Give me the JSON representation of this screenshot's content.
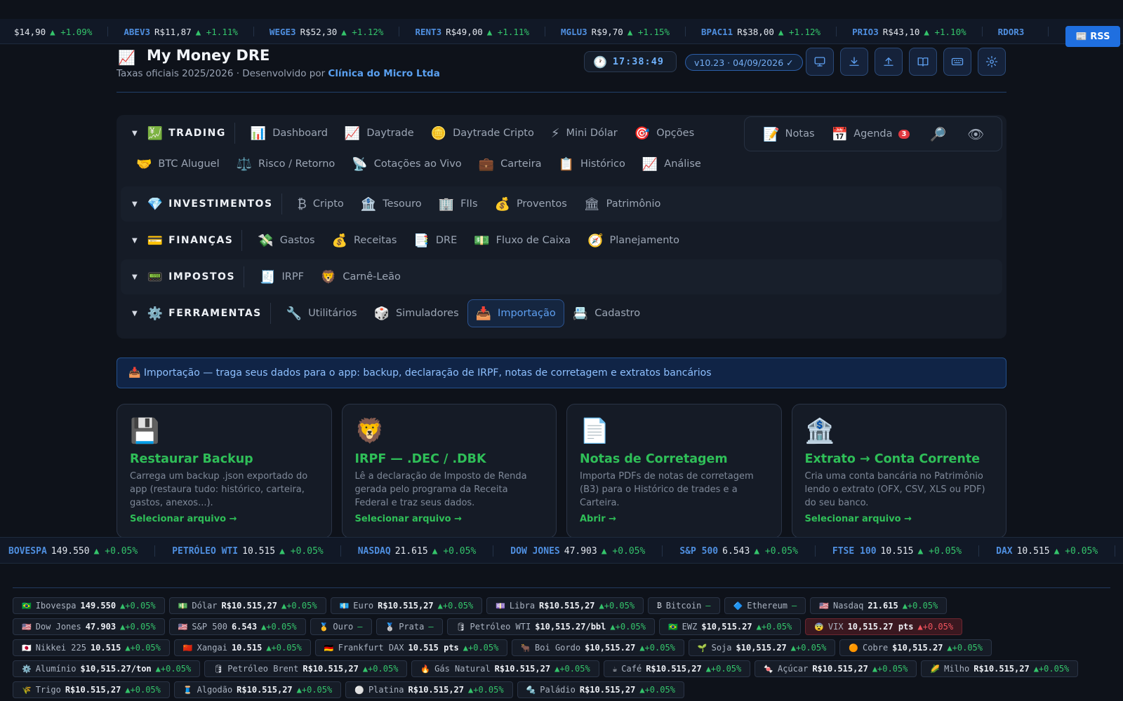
{
  "ticker_top": [
    {
      "symbol": "",
      "price": "$14,90",
      "change": "▲ +1.09%"
    },
    {
      "symbol": "ABEV3",
      "price": "R$11,87",
      "change": "▲ +1.11%"
    },
    {
      "symbol": "WEGE3",
      "price": "R$52,30",
      "change": "▲ +1.12%"
    },
    {
      "symbol": "RENT3",
      "price": "R$49,00",
      "change": "▲ +1.11%"
    },
    {
      "symbol": "MGLU3",
      "price": "R$9,70",
      "change": "▲ +1.15%"
    },
    {
      "symbol": "BPAC11",
      "price": "R$38,00",
      "change": "▲ +1.12%"
    },
    {
      "symbol": "PRIO3",
      "price": "R$43,10",
      "change": "▲ +1.10%"
    },
    {
      "symbol": "RDOR3",
      "price": "",
      "change": ""
    }
  ],
  "rss_label": "📰 RSS",
  "header": {
    "logo_icon": "📈",
    "title": "My Money DRE",
    "subtitle_prefix": "Taxas oficiais 2025/2026 · Desenvolvido por ",
    "developer": "Clínica do Micro Ltda",
    "clock_icon": "🕐",
    "clock": "17:38:49",
    "version": "v10.23 · 04/09/2026 ✓",
    "buttons": [
      "monitor-icon",
      "download-icon",
      "upload-icon",
      "book-icon",
      "keyboard-icon",
      "gear-icon"
    ]
  },
  "nav": {
    "sections": [
      {
        "icon": "💹",
        "label": "TRADING",
        "items": [
          {
            "icon": "📊",
            "label": "Dashboard"
          },
          {
            "icon": "📈",
            "label": "Daytrade"
          },
          {
            "icon": "🪙",
            "label": "Daytrade Cripto"
          },
          {
            "icon": "⚡",
            "label": "Mini Dólar"
          },
          {
            "icon": "🎯",
            "label": "Opções"
          }
        ],
        "items2": [
          {
            "icon": "🤝",
            "label": "BTC Aluguel"
          },
          {
            "icon": "⚖️",
            "label": "Risco / Retorno"
          },
          {
            "icon": "📡",
            "label": "Cotações ao Vivo"
          },
          {
            "icon": "💼",
            "label": "Carteira"
          },
          {
            "icon": "📋",
            "label": "Histórico"
          },
          {
            "icon": "📈",
            "label": "Análise"
          }
        ]
      },
      {
        "icon": "💎",
        "label": "INVESTIMENTOS",
        "items": [
          {
            "icon": "₿",
            "label": "Cripto"
          },
          {
            "icon": "🏦",
            "label": "Tesouro"
          },
          {
            "icon": "🏢",
            "label": "FIIs"
          },
          {
            "icon": "💰",
            "label": "Proventos"
          },
          {
            "icon": "🏛",
            "label": "Patrimônio"
          }
        ]
      },
      {
        "icon": "💳",
        "label": "FINANÇAS",
        "items": [
          {
            "icon": "💸",
            "label": "Gastos"
          },
          {
            "icon": "💰",
            "label": "Receitas"
          },
          {
            "icon": "📑",
            "label": "DRE"
          },
          {
            "icon": "💵",
            "label": "Fluxo de Caixa"
          },
          {
            "icon": "🧭",
            "label": "Planejamento"
          }
        ]
      },
      {
        "icon": "📟",
        "label": "IMPOSTOS",
        "items": [
          {
            "icon": "🧾",
            "label": "IRPF"
          },
          {
            "icon": "🦁",
            "label": "Carnê-Leão"
          }
        ]
      },
      {
        "icon": "⚙️",
        "label": "FERRAMENTAS",
        "items": [
          {
            "icon": "🔧",
            "label": "Utilitários"
          },
          {
            "icon": "🎲",
            "label": "Simuladores"
          },
          {
            "icon": "📥",
            "label": "Importação",
            "active": true
          },
          {
            "icon": "📇",
            "label": "Cadastro"
          }
        ]
      }
    ],
    "utility": {
      "notes_icon": "📝",
      "notes": "Notas",
      "agenda_icon": "📅",
      "agenda": "Agenda",
      "agenda_badge": "3",
      "search_icon": "🔎",
      "eye_icon": "👁"
    },
    "caret": "▼"
  },
  "banner": "📥 Importação — traga seus dados para o app: backup, declaração de IRPF, notas de corretagem e extratos bancários",
  "cards": [
    {
      "icon": "💾",
      "title": "Restaurar Backup",
      "desc": "Carrega um backup .json exportado do app (restaura tudo: histórico, carteira, gastos, anexos...).",
      "link": "Selecionar arquivo →"
    },
    {
      "icon": "🦁",
      "title": "IRPF — .DEC / .DBK",
      "desc": "Lê a declaração de Imposto de Renda gerada pelo programa da Receita Federal e traz seus dados.",
      "link": "Selecionar arquivo →"
    },
    {
      "icon": "📄",
      "title": "Notas de Corretagem",
      "desc": "Importa PDFs de notas de corretagem (B3) para o Histórico de trades e a Carteira.",
      "link": "Abrir →"
    },
    {
      "icon": "🏦",
      "title": "Extrato → Conta Corrente",
      "desc": "Cria uma conta bancária no Patrimônio lendo o extrato (OFX, CSV, XLS ou PDF) do seu banco.",
      "link": "Selecionar arquivo →"
    }
  ],
  "ticker_bottom": [
    {
      "symbol": "BOVESPA",
      "price": "149.550",
      "change": "▲ +0.05%"
    },
    {
      "symbol": "PETRÓLEO WTI",
      "price": "10.515",
      "change": "▲ +0.05%"
    },
    {
      "symbol": "NASDAQ",
      "price": "21.615",
      "change": "▲ +0.05%"
    },
    {
      "symbol": "DOW JONES",
      "price": "47.903",
      "change": "▲ +0.05%"
    },
    {
      "symbol": "S&P 500",
      "price": "6.543",
      "change": "▲ +0.05%"
    },
    {
      "symbol": "FTSE 100",
      "price": "10.515",
      "change": "▲ +0.05%"
    },
    {
      "symbol": "DAX",
      "price": "10.515",
      "change": "▲ +0.05%"
    }
  ],
  "markets": [
    [
      {
        "flag": "🇧🇷",
        "name": "Ibovespa",
        "value": "149.550",
        "change": "▲+0.05%"
      },
      {
        "flag": "💵",
        "name": "Dólar",
        "value": "R$10.515,27",
        "change": "▲+0.05%"
      },
      {
        "flag": "💶",
        "name": "Euro",
        "value": "R$10.515,27",
        "change": "▲+0.05%"
      },
      {
        "flag": "💷",
        "name": "Libra",
        "value": "R$10.515,27",
        "change": "▲+0.05%"
      },
      {
        "flag": "₿",
        "name": "Bitcoin",
        "value": "",
        "change": "—"
      },
      {
        "flag": "🔷",
        "name": "Ethereum",
        "value": "",
        "change": "—"
      },
      {
        "flag": "🇺🇸",
        "name": "Nasdaq",
        "value": "21.615",
        "change": "▲+0.05%"
      }
    ],
    [
      {
        "flag": "🇺🇸",
        "name": "Dow Jones",
        "value": "47.903",
        "change": "▲+0.05%"
      },
      {
        "flag": "🇺🇸",
        "name": "S&P 500",
        "value": "6.543",
        "change": "▲+0.05%"
      },
      {
        "flag": "🥇",
        "name": "Ouro",
        "value": "",
        "change": "—"
      },
      {
        "flag": "🥈",
        "name": "Prata",
        "value": "",
        "change": "—"
      },
      {
        "flag": "🛢",
        "name": "Petróleo WTI",
        "value": "$10,515.27/bbl",
        "change": "▲+0.05%"
      },
      {
        "flag": "🇧🇷",
        "name": "EWZ",
        "value": "$10,515.27",
        "change": "▲+0.05%"
      },
      {
        "flag": "😨",
        "name": "VIX",
        "value": "10,515.27 pts",
        "change": "▲+0.05%",
        "warn": true
      }
    ],
    [
      {
        "flag": "🇯🇵",
        "name": "Nikkei 225",
        "value": "10.515",
        "change": "▲+0.05%"
      },
      {
        "flag": "🇨🇳",
        "name": "Xangai",
        "value": "10.515",
        "change": "▲+0.05%"
      },
      {
        "flag": "🇩🇪",
        "name": "Frankfurt DAX",
        "value": "10.515 pts",
        "change": "▲+0.05%"
      },
      {
        "flag": "🐂",
        "name": "Boi Gordo",
        "value": "$10,515.27",
        "change": "▲+0.05%"
      },
      {
        "flag": "🌱",
        "name": "Soja",
        "value": "$10,515.27",
        "change": "▲+0.05%"
      },
      {
        "flag": "🟠",
        "name": "Cobre",
        "value": "$10,515.27",
        "change": "▲+0.05%"
      }
    ],
    [
      {
        "flag": "⚙️",
        "name": "Alumínio",
        "value": "$10,515.27/ton",
        "change": "▲+0.05%"
      },
      {
        "flag": "🛢",
        "name": "Petróleo Brent",
        "value": "R$10.515,27",
        "change": "▲+0.05%"
      },
      {
        "flag": "🔥",
        "name": "Gás Natural",
        "value": "R$10.515,27",
        "change": "▲+0.05%"
      },
      {
        "flag": "☕",
        "name": "Café",
        "value": "R$10.515,27",
        "change": "▲+0.05%"
      },
      {
        "flag": "🍬",
        "name": "Açúcar",
        "value": "R$10.515,27",
        "change": "▲+0.05%"
      },
      {
        "flag": "🌽",
        "name": "Milho",
        "value": "R$10.515,27",
        "change": "▲+0.05%"
      }
    ],
    [
      {
        "flag": "🌾",
        "name": "Trigo",
        "value": "R$10.515,27",
        "change": "▲+0.05%"
      },
      {
        "flag": "🧵",
        "name": "Algodão",
        "value": "R$10.515,27",
        "change": "▲+0.05%"
      },
      {
        "flag": "⚪",
        "name": "Platina",
        "value": "R$10.515,27",
        "change": "▲+0.05%"
      },
      {
        "flag": "🔩",
        "name": "Paládio",
        "value": "R$10.515,27",
        "change": "▲+0.05%"
      }
    ]
  ]
}
